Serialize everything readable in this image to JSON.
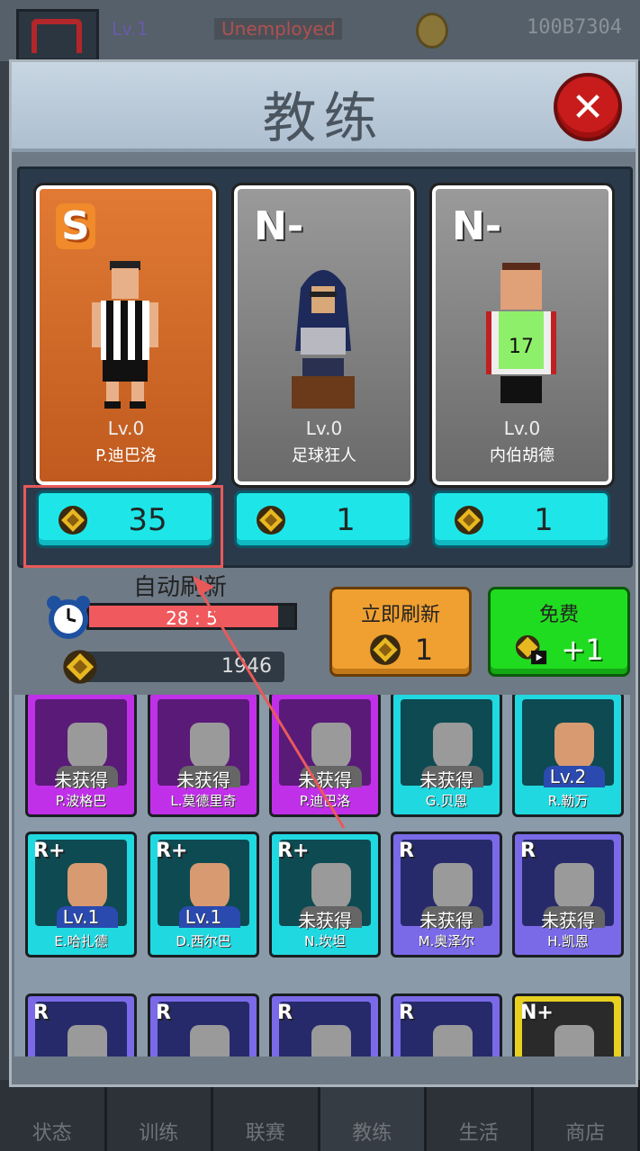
{
  "topbar": {
    "level": "Lv.1",
    "job": "Unemployed",
    "money": "100B7304"
  },
  "modal": {
    "title": "教练"
  },
  "featured": [
    {
      "grade": "S",
      "level": "Lv.0",
      "name": "P.迪巴洛",
      "price": "35"
    },
    {
      "grade": "N-",
      "level": "Lv.0",
      "name": "足球狂人",
      "price": "1"
    },
    {
      "grade": "N-",
      "level": "Lv.0",
      "name": "内伯胡德",
      "price": "1"
    }
  ],
  "auto_refresh": {
    "label": "自动刷新",
    "timer": "28 : 5",
    "progress": 0.92
  },
  "gem_balance": "1946",
  "refresh_now": {
    "label": "立即刷新",
    "cost": "1"
  },
  "free": {
    "label": "免费",
    "reward": "+1"
  },
  "collection": [
    {
      "badge": "",
      "status": "未获得",
      "name": "P.波格巴",
      "color": "purple"
    },
    {
      "badge": "",
      "status": "未获得",
      "name": "L.莫德里奇",
      "color": "purple"
    },
    {
      "badge": "",
      "status": "未获得",
      "name": "P.迪巴洛",
      "color": "purple"
    },
    {
      "badge": "",
      "status": "未获得",
      "name": "G.贝恩",
      "color": "cyan"
    },
    {
      "badge": "",
      "status": "Lv.2",
      "name": "R.勒万",
      "color": "cyan"
    },
    {
      "badge": "R+",
      "status": "Lv.1",
      "name": "E.哈扎德",
      "color": "cyan"
    },
    {
      "badge": "R+",
      "status": "Lv.1",
      "name": "D.西尔巴",
      "color": "cyan"
    },
    {
      "badge": "R+",
      "status": "未获得",
      "name": "N.坎坦",
      "color": "cyan"
    },
    {
      "badge": "R",
      "status": "未获得",
      "name": "M.奥泽尔",
      "color": "blue"
    },
    {
      "badge": "R",
      "status": "未获得",
      "name": "H.凯恩",
      "color": "blue"
    },
    {
      "badge": "R",
      "status": "",
      "name": "",
      "color": "blue"
    },
    {
      "badge": "R",
      "status": "",
      "name": "",
      "color": "blue"
    },
    {
      "badge": "R",
      "status": "",
      "name": "",
      "color": "blue"
    },
    {
      "badge": "R",
      "status": "",
      "name": "",
      "color": "blue"
    },
    {
      "badge": "N+",
      "status": "",
      "name": "",
      "color": "yellow"
    }
  ],
  "nav": [
    "状态",
    "训练",
    "联赛",
    "教练",
    "生活",
    "商店"
  ],
  "colors": {
    "accent_cyan": "#1ee6e8",
    "orange": "#f0a030",
    "green": "#20dc20",
    "close_red": "#c81c1c"
  }
}
